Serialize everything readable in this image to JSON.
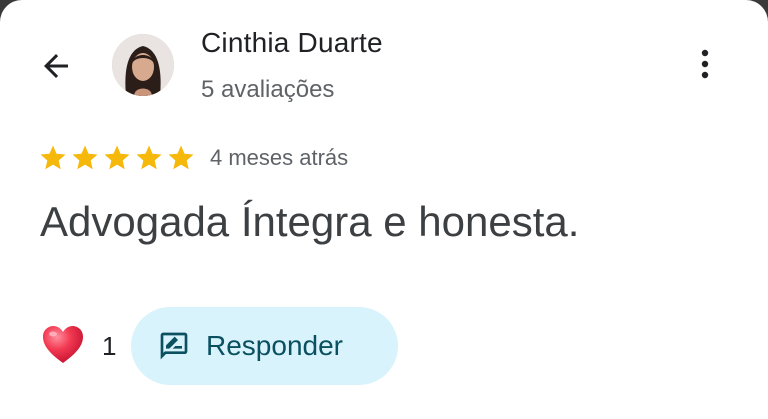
{
  "header": {
    "back_icon": "arrow-back-icon",
    "reviewer_name": "Cinthia Duarte",
    "reviewer_meta": "5 avaliações",
    "menu_icon": "more-vert-icon"
  },
  "review": {
    "rating": 5,
    "rating_max": 5,
    "star_color": "#F6B80A",
    "time": "4 meses atrás",
    "text": "Advogada Íntegra e honesta."
  },
  "actions": {
    "like_icon": "heart-icon",
    "like_count": "1",
    "reply_icon": "rate-review-icon",
    "reply_label": "Responder",
    "reply_bg": "#D8F3FB",
    "reply_color": "#0B5060"
  }
}
